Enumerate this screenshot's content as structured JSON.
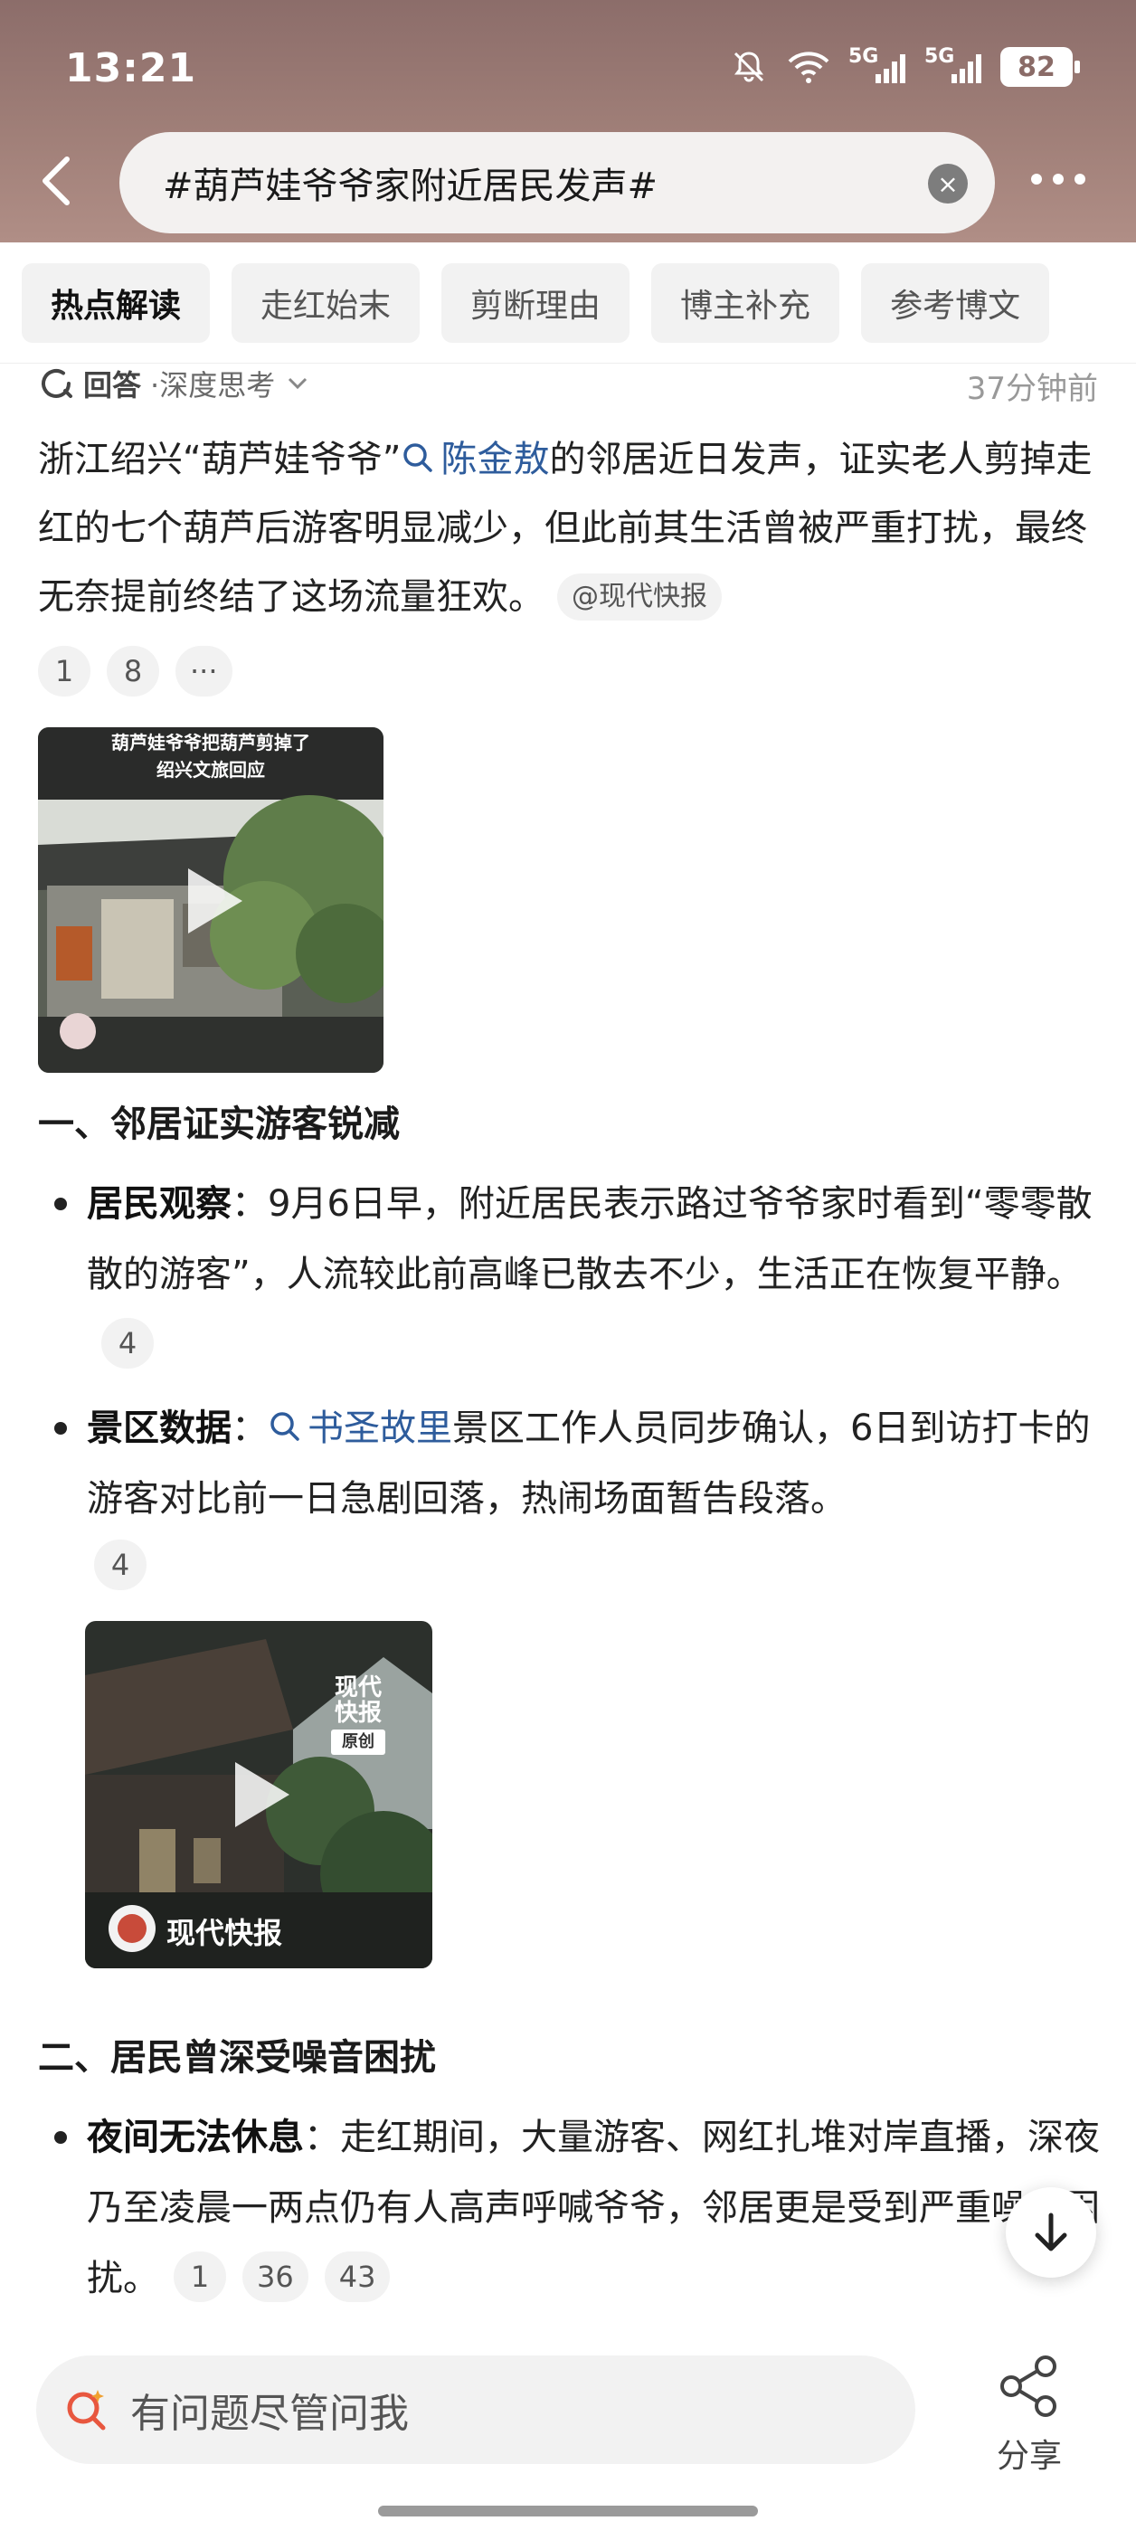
{
  "status_bar": {
    "time": "13:21",
    "network_1": "5G",
    "network_2": "5G",
    "battery": "82"
  },
  "search": {
    "query": "#葫芦娃爷爷家附近居民发声#"
  },
  "tabs": [
    {
      "label": "热点解读",
      "active": true
    },
    {
      "label": "走红始末",
      "active": false
    },
    {
      "label": "剪断理由",
      "active": false
    },
    {
      "label": "博主补充",
      "active": false
    },
    {
      "label": "参考博文",
      "active": false
    }
  ],
  "answer": {
    "label": "回答",
    "mode": "·深度思考",
    "time": "37分钟前"
  },
  "intro": {
    "part1": "浙江绍兴“葫芦娃爷爷”",
    "link": "陈金敖",
    "part2": "的邻居近日发声，证实老人剪掉走红的七个葫芦后游客明显减少，但此前其生活曾被严重打扰，最终无奈提前终结了这场流量狂欢。",
    "source": "@现代快报",
    "refs": [
      "1",
      "8",
      "···"
    ]
  },
  "video1": {
    "caption_line1": "葫芦娃爷爷把葫芦剪掉了",
    "caption_line2": "绍兴文旅回应"
  },
  "section1": {
    "heading": "一、邻居证实游客锐减",
    "items": [
      {
        "title": "居民观察",
        "text": "：9月6日早，附近居民表示路过爷爷家时看到“零零散散的游客”，人流较此前高峰已散去不少，生活正在恢复平静。",
        "refs": [
          "4"
        ]
      },
      {
        "title": "景区数据",
        "pre": "：",
        "link": "书圣故里",
        "text": "景区工作人员同步确认，6日到访打卡的游客对比前一日急剧回落，热闹场面暂告段落。",
        "refs": [
          "4"
        ]
      }
    ]
  },
  "video2": {
    "watermark": "现代快报",
    "watermark_sub": "原创",
    "channel": "现代快报"
  },
  "section2": {
    "heading": "二、居民曾深受噪音困扰",
    "items": [
      {
        "title": "夜间无法休息",
        "text": "：走红期间，大量游客、网红扎堆对岸直播，深夜乃至凌晨一两点仍有人高声呼喊爷爷，邻居更是受到严重噪音困扰。",
        "refs": [
          "1",
          "36",
          "43"
        ]
      }
    ]
  },
  "bottom": {
    "ask_placeholder": "有问题尽管问我",
    "share_label": "分享"
  },
  "colors": {
    "header_bg": "#a07f78",
    "link": "#2e5c9c",
    "chip_bg": "#f2f2f2"
  }
}
